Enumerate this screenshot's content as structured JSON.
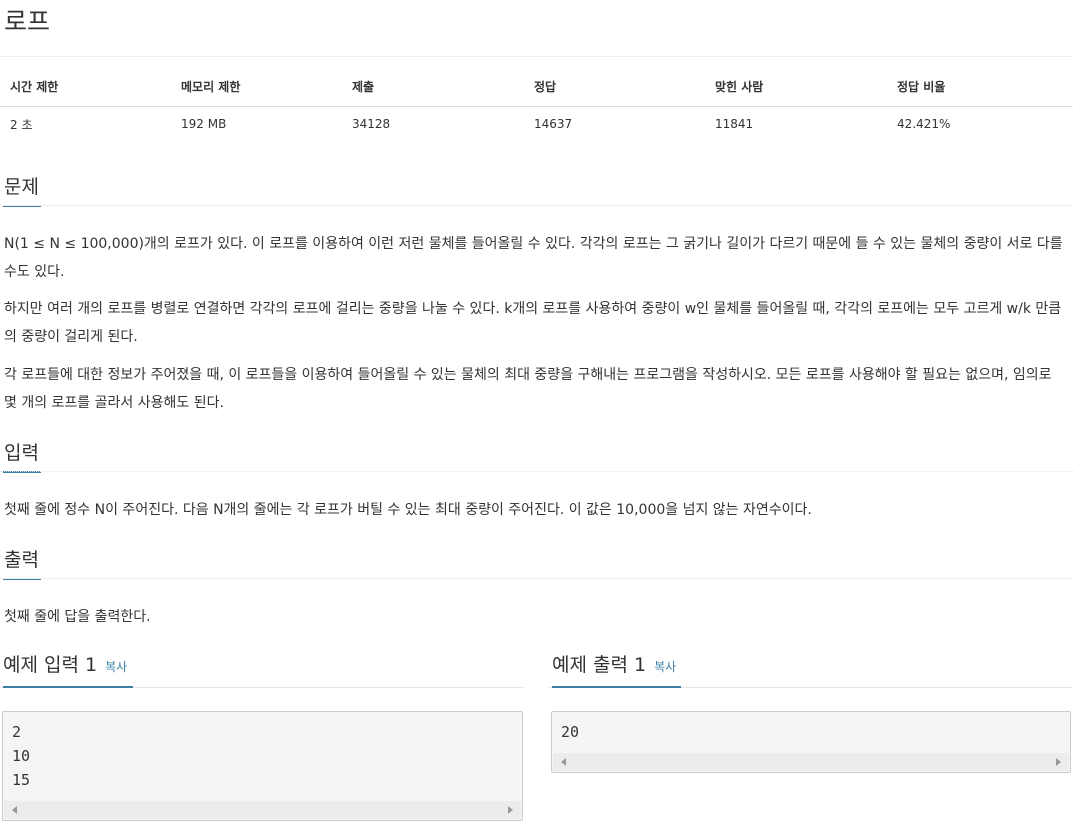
{
  "problem": {
    "title": "로프"
  },
  "info_table": {
    "headers": [
      "시간 제한",
      "메모리 제한",
      "제출",
      "정답",
      "맞힌 사람",
      "정답 비율"
    ],
    "values": [
      "2 초",
      "192 MB",
      "34128",
      "14637",
      "11841",
      "42.421%"
    ]
  },
  "sections": {
    "description": {
      "heading": "문제",
      "paragraphs": [
        "N(1 ≤ N ≤ 100,000)개의 로프가 있다. 이 로프를 이용하여 이런 저런 물체를 들어올릴 수 있다. 각각의 로프는 그 굵기나 길이가 다르기 때문에 들 수 있는 물체의 중량이 서로 다를 수도 있다.",
        "하지만 여러 개의 로프를 병렬로 연결하면 각각의 로프에 걸리는 중량을 나눌 수 있다. k개의 로프를 사용하여 중량이 w인 물체를 들어올릴 때, 각각의 로프에는 모두 고르게 w/k 만큼의 중량이 걸리게 된다.",
        "각 로프들에 대한 정보가 주어졌을 때, 이 로프들을 이용하여 들어올릴 수 있는 물체의 최대 중량을 구해내는 프로그램을 작성하시오. 모든 로프를 사용해야 할 필요는 없으며, 임의로 몇 개의 로프를 골라서 사용해도 된다."
      ]
    },
    "input": {
      "heading": "입력",
      "text": "첫째 줄에 정수 N이 주어진다. 다음 N개의 줄에는 각 로프가 버틸 수 있는 최대 중량이 주어진다. 이 값은 10,000을 넘지 않는 자연수이다."
    },
    "output": {
      "heading": "출력",
      "text": "첫째 줄에 답을 출력한다."
    }
  },
  "samples": {
    "input": {
      "title": "예제 입력 1",
      "copy_label": "복사",
      "lines": [
        "2",
        "10",
        "15"
      ]
    },
    "output": {
      "title": "예제 출력 1",
      "copy_label": "복사",
      "lines": [
        "20"
      ]
    }
  },
  "colors": {
    "accent": "#3f7fa6",
    "text": "#333333",
    "pre_background": "#f5f5f5"
  }
}
